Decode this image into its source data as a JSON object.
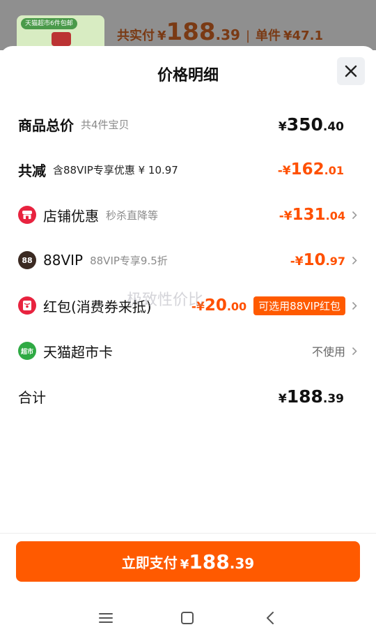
{
  "background_header": {
    "thumb_banner": "天猫超市6件包邮",
    "total_label": "共实付",
    "total_currency": "¥",
    "total_int": "188",
    "total_dec": ".39",
    "separator": "|",
    "unit_label": "单件",
    "unit_price": "¥47.1"
  },
  "sheet": {
    "title": "价格明细",
    "close_icon": "close-icon"
  },
  "rows": {
    "goods_total": {
      "label": "商品总价",
      "sub": "共4件宝贝",
      "currency": "¥",
      "int": "350",
      "dec": ".40"
    },
    "total_discount": {
      "label": "共减",
      "sub": "含88VIP专享优惠 ¥ 10.97",
      "currency": "-¥",
      "int": "162",
      "dec": ".01"
    },
    "store_discount": {
      "label": "店铺优惠",
      "sub": "秒杀直降等",
      "currency": "-¥",
      "int": "131",
      "dec": ".04",
      "icon": "store-icon"
    },
    "vip": {
      "label": "88VIP",
      "sub": "88VIP专享9.5折",
      "currency": "-¥",
      "int": "10",
      "dec": ".97",
      "icon": "88vip-icon",
      "icon_text": "88"
    },
    "red_packet": {
      "label": "红包(消费券来抵)",
      "currency": "-¥",
      "int": "20",
      "dec": ".00",
      "tag": "可选用88VIP红包",
      "icon": "red-packet-icon"
    },
    "tmall_card": {
      "label": "天猫超市卡",
      "value": "不使用",
      "icon": "supermarket-card-icon",
      "icon_text": "超市"
    },
    "sum": {
      "label": "合计",
      "currency": "¥",
      "int": "188",
      "dec": ".39"
    }
  },
  "pay_button": {
    "label": "立即支付",
    "currency": "¥",
    "int": "188",
    "dec": ".39"
  },
  "watermark": "极致性价比",
  "navbar": {
    "items": [
      "menu-icon",
      "home-icon",
      "back-icon"
    ]
  },
  "colors": {
    "accent": "#ff5000",
    "button": "#ff5a00",
    "store_icon": "#e8233f",
    "vip_icon": "#3b2a22",
    "card_icon": "#2faa44"
  }
}
